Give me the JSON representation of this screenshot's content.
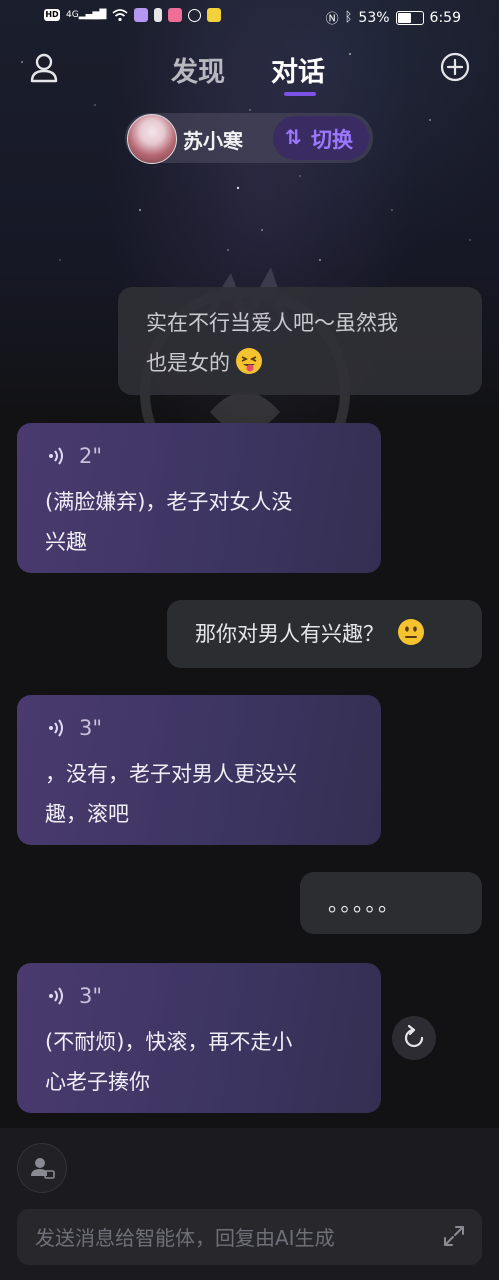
{
  "status_bar": {
    "left_icons": [
      "hd-icon",
      "signal-4g-icon",
      "wifi-icon",
      "app-icon",
      "battery-saver-icon",
      "app-icon",
      "app-icon",
      "app-icon"
    ],
    "network": "4G",
    "battery_percent": "53%",
    "time": "6:59"
  },
  "header": {
    "tabs": [
      {
        "label": "发现",
        "active": false
      },
      {
        "label": "对话",
        "active": true
      }
    ]
  },
  "agent": {
    "name": "苏小寒",
    "switch_label": "切换"
  },
  "messages": [
    {
      "role": "user",
      "text": "实在不行当爱人吧～虽然我\n也是女的",
      "emoji": "squinting-face-with-tongue"
    },
    {
      "role": "ai",
      "voice_duration": "2\"",
      "text": "(满脸嫌弃)，老子对女人没\n兴趣"
    },
    {
      "role": "user",
      "text": "那你对男人有兴趣？",
      "emoji": "neutral-face"
    },
    {
      "role": "ai",
      "voice_duration": "3\"",
      "text": "，没有，老子对男人更没兴\n趣，滚吧"
    },
    {
      "role": "user",
      "text": "。。。。。"
    },
    {
      "role": "ai",
      "voice_duration": "3\"",
      "text": "(不耐烦)，快滚，再不走小\n心老子揍你"
    }
  ],
  "input": {
    "placeholder": "发送消息给智能体，回复由AI生成"
  },
  "colors": {
    "accent": "#7b52e6",
    "ai_bubble": "#433867",
    "user_bubble": "#2c2d31",
    "background": "#121214"
  }
}
